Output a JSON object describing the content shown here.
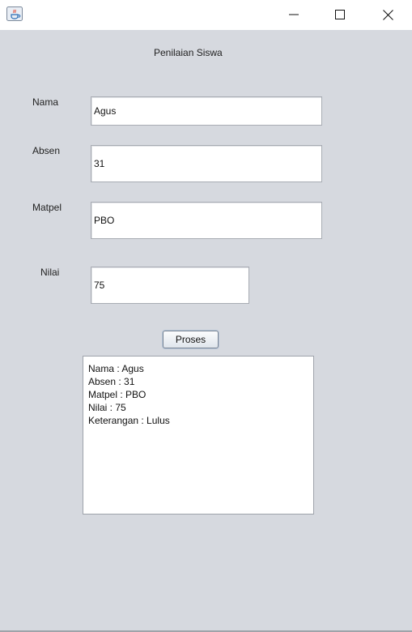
{
  "window": {
    "title": "",
    "controls": [
      "minimize-icon",
      "maximize-icon",
      "close-icon"
    ]
  },
  "form": {
    "heading": "Penilaian Siswa",
    "fields": [
      {
        "label": "Nama",
        "value": "Agus"
      },
      {
        "label": "Absen",
        "value": "31"
      },
      {
        "label": "Matpel",
        "value": "PBO"
      },
      {
        "label": "Nilai",
        "value": "75"
      }
    ],
    "submit_label": "Proses"
  },
  "output": {
    "lines": [
      "Nama : Agus",
      "Absen : 31",
      "Matpel : PBO",
      "Nilai : 75",
      "Keterangan : Lulus"
    ]
  },
  "colors": {
    "background": "#d6d9df",
    "titlebar": "#ffffff",
    "field_border": "#a8acb3"
  }
}
